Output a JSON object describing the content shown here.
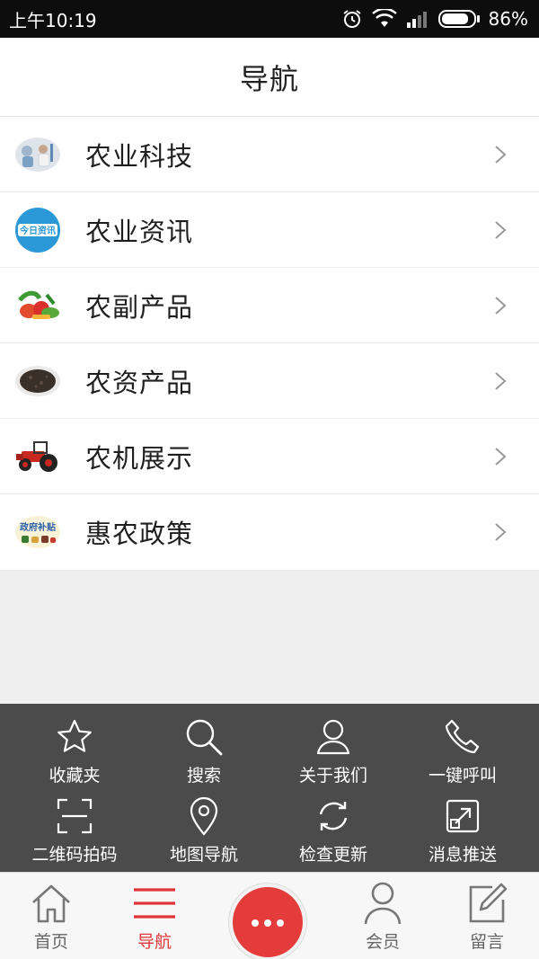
{
  "status_bar": {
    "time": "上午10:19",
    "battery": "86%",
    "battery_level": 0.86
  },
  "header": {
    "title": "导航"
  },
  "menu": [
    {
      "label": "农业科技",
      "icon": "lab-photo-icon"
    },
    {
      "label": "农业资讯",
      "icon": "news-badge-icon",
      "badge_text": "今日资讯"
    },
    {
      "label": "农副产品",
      "icon": "vegetables-icon"
    },
    {
      "label": "农资产品",
      "icon": "fertilizer-pile-icon"
    },
    {
      "label": "农机展示",
      "icon": "tractor-icon"
    },
    {
      "label": "惠农政策",
      "icon": "policy-banner-icon",
      "badge_text": "政府补贴"
    }
  ],
  "quick_panel": [
    {
      "label": "收藏夹",
      "icon": "star-icon"
    },
    {
      "label": "搜索",
      "icon": "search-icon"
    },
    {
      "label": "关于我们",
      "icon": "user-icon"
    },
    {
      "label": "一键呼叫",
      "icon": "phone-icon"
    },
    {
      "label": "二维码拍码",
      "icon": "scan-icon"
    },
    {
      "label": "地图导航",
      "icon": "map-pin-icon"
    },
    {
      "label": "检查更新",
      "icon": "refresh-icon"
    },
    {
      "label": "消息推送",
      "icon": "share-box-icon"
    }
  ],
  "tabs": [
    {
      "label": "首页",
      "icon": "home-icon"
    },
    {
      "label": "导航",
      "icon": "menu-lines-icon",
      "active": true
    },
    {
      "label": "会员",
      "icon": "member-icon"
    },
    {
      "label": "留言",
      "icon": "edit-icon"
    }
  ],
  "colors": {
    "accent": "#e43b3b",
    "panel": "#4b4b4b",
    "status_bar": "#0d0d0d"
  }
}
